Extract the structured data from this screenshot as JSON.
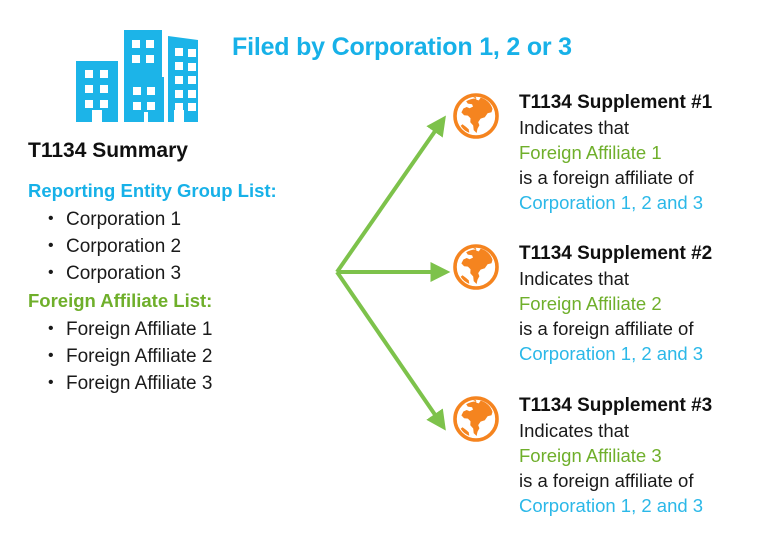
{
  "banner": {
    "title": "Filed by Corporation 1, 2 or 3"
  },
  "colors": {
    "blue": "#17B1E8",
    "light_blue": "#2BB8E8",
    "green": "#6FAF2B",
    "arrow_green": "#7DC24B",
    "orange": "#F5841F",
    "black": "#101010"
  },
  "summary": {
    "title": "T1134 Summary",
    "reporting_entity_heading": "Reporting Entity Group List:",
    "reporting_entities": [
      "Corporation 1",
      "Corporation 2",
      "Corporation 3"
    ],
    "foreign_affiliate_heading": "Foreign Affiliate List:",
    "foreign_affiliates": [
      "Foreign Affiliate 1",
      "Foreign Affiliate 2",
      "Foreign Affiliate 3"
    ]
  },
  "icons": {
    "city": "city-buildings-icon",
    "globe": "globe-icon",
    "arrow": "arrow-icon"
  },
  "supplements": [
    {
      "heading": "T1134 Supplement #1",
      "line1": "Indicates that",
      "affiliate": "Foreign Affiliate 1",
      "line2": "is a foreign affiliate of",
      "corporations": "Corporation 1, 2 and 3"
    },
    {
      "heading": "T1134 Supplement #2",
      "line1": "Indicates that",
      "affiliate": "Foreign Affiliate 2",
      "line2": "is a foreign affiliate of",
      "corporations": "Corporation 1, 2 and 3"
    },
    {
      "heading": "T1134 Supplement #3",
      "line1": "Indicates that",
      "affiliate": "Foreign Affiliate 3",
      "line2": "is a foreign affiliate of",
      "corporations": "Corporation 1, 2 and 3"
    }
  ]
}
